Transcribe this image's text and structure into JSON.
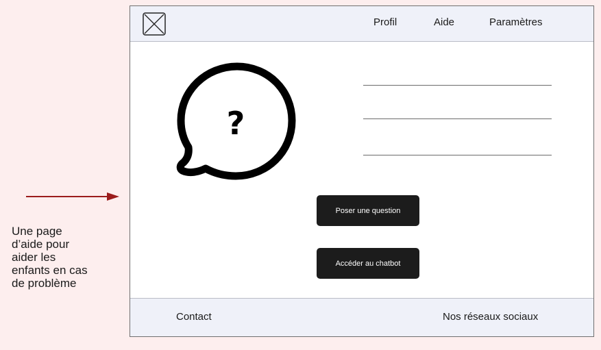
{
  "annotation": {
    "caption": "Une page\nd’aide pour\naider les\nenfants en cas\nde problème",
    "arrow_color": "#9b1c1c"
  },
  "header": {
    "logo_icon": "image-placeholder-icon",
    "nav": {
      "profil": "Profil",
      "aide": "Aide",
      "parametres": "Paramètres"
    }
  },
  "main": {
    "illustration_icon": "question-speech-bubble-icon",
    "question_mark": "?",
    "buttons": {
      "ask_question": "Poser une question",
      "chatbot": "Accéder au chatbot"
    }
  },
  "footer": {
    "contact": "Contact",
    "social": "Nos réseaux sociaux"
  }
}
